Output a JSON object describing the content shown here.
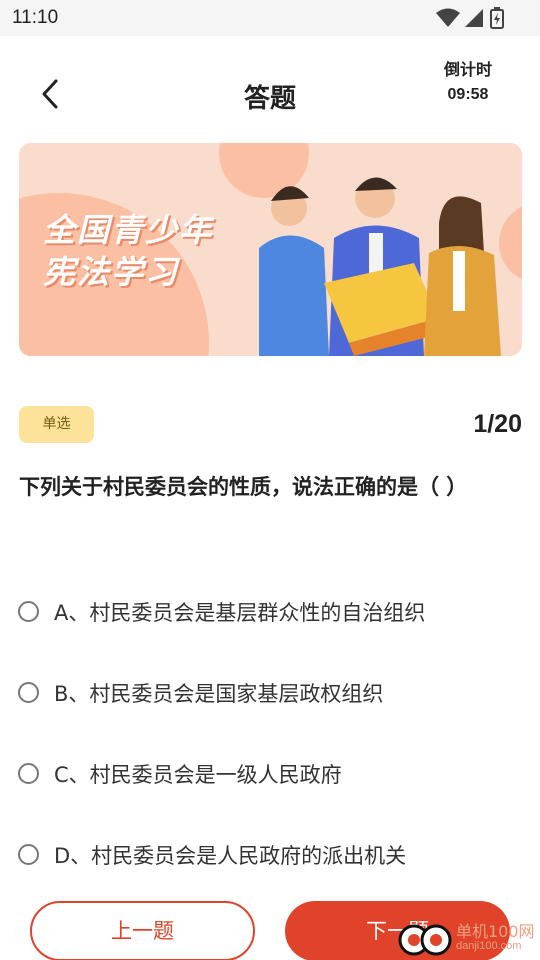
{
  "status_bar": {
    "time": "11:10"
  },
  "header": {
    "title": "答题",
    "countdown_label": "倒计时",
    "countdown_value": "09:58"
  },
  "banner": {
    "line1": "全国青少年",
    "line2": "宪法学习"
  },
  "question": {
    "type": "单选",
    "progress": "1/20",
    "text": "下列关于村民委员会的性质，说法正确的是（  ）",
    "options": [
      "A、村民委员会是基层群众性的自治组织",
      "B、村民委员会是国家基层政权组织",
      "C、村民委员会是一级人民政府",
      "D、村民委员会是人民政府的派出机关"
    ]
  },
  "footer": {
    "prev_label": "上一题",
    "next_label": "下一题"
  },
  "watermark": {
    "line1": "单机100网",
    "line2": "danji100.com"
  },
  "colors": {
    "accent": "#e1432a",
    "badge": "#fde29a",
    "banner_bg": "#f7d3c0"
  },
  "icons": [
    "wifi-icon",
    "signal-icon",
    "battery-icon",
    "back-arrow-icon",
    "radio-icon"
  ]
}
